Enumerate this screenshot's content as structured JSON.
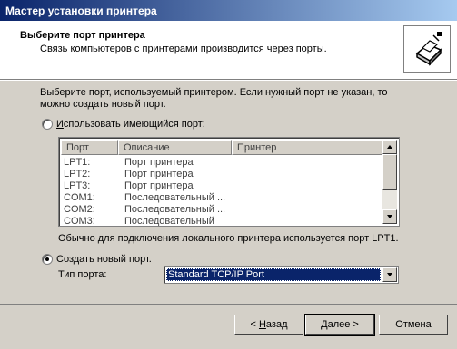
{
  "window": {
    "title": "Мастер установки принтера"
  },
  "header": {
    "title": "Выберите порт принтера",
    "subtitle": "Связь компьютеров с принтерами производится через порты."
  },
  "intro": {
    "line1": "Выберите порт, используемый принтером. Если нужный порт не указан, то",
    "line2": "можно создать новый порт."
  },
  "existing_port": {
    "label": "Использовать имеющийся порт:",
    "selected": false,
    "columns": [
      "Порт",
      "Описание",
      "Принтер"
    ],
    "rows": [
      {
        "port": "LPT1:",
        "description": "Порт принтера",
        "printer": ""
      },
      {
        "port": "LPT2:",
        "description": "Порт принтера",
        "printer": ""
      },
      {
        "port": "LPT3:",
        "description": "Порт принтера",
        "printer": ""
      },
      {
        "port": "COM1:",
        "description": "Последовательный ...",
        "printer": ""
      },
      {
        "port": "COM2:",
        "description": "Последовательный ...",
        "printer": ""
      },
      {
        "port": "COM3:",
        "description": "Последовательный",
        "printer": ""
      }
    ]
  },
  "hint": "Обычно для подключения локального принтера используется порт LPT1.",
  "new_port": {
    "label": "Создать новый порт.",
    "selected": true,
    "type_label": "Тип порта:",
    "type_value": "Standard TCP/IP Port"
  },
  "buttons": {
    "back_prefix": "< ",
    "back_hotkey": "Н",
    "back_rest": "азад",
    "next_label": "Далее >",
    "cancel_label": "Отмена"
  },
  "icons": {
    "header": "printer-port-icon",
    "scroll_up": "scroll-up-icon",
    "scroll_down": "scroll-down-icon",
    "combo": "chevron-down-icon"
  }
}
